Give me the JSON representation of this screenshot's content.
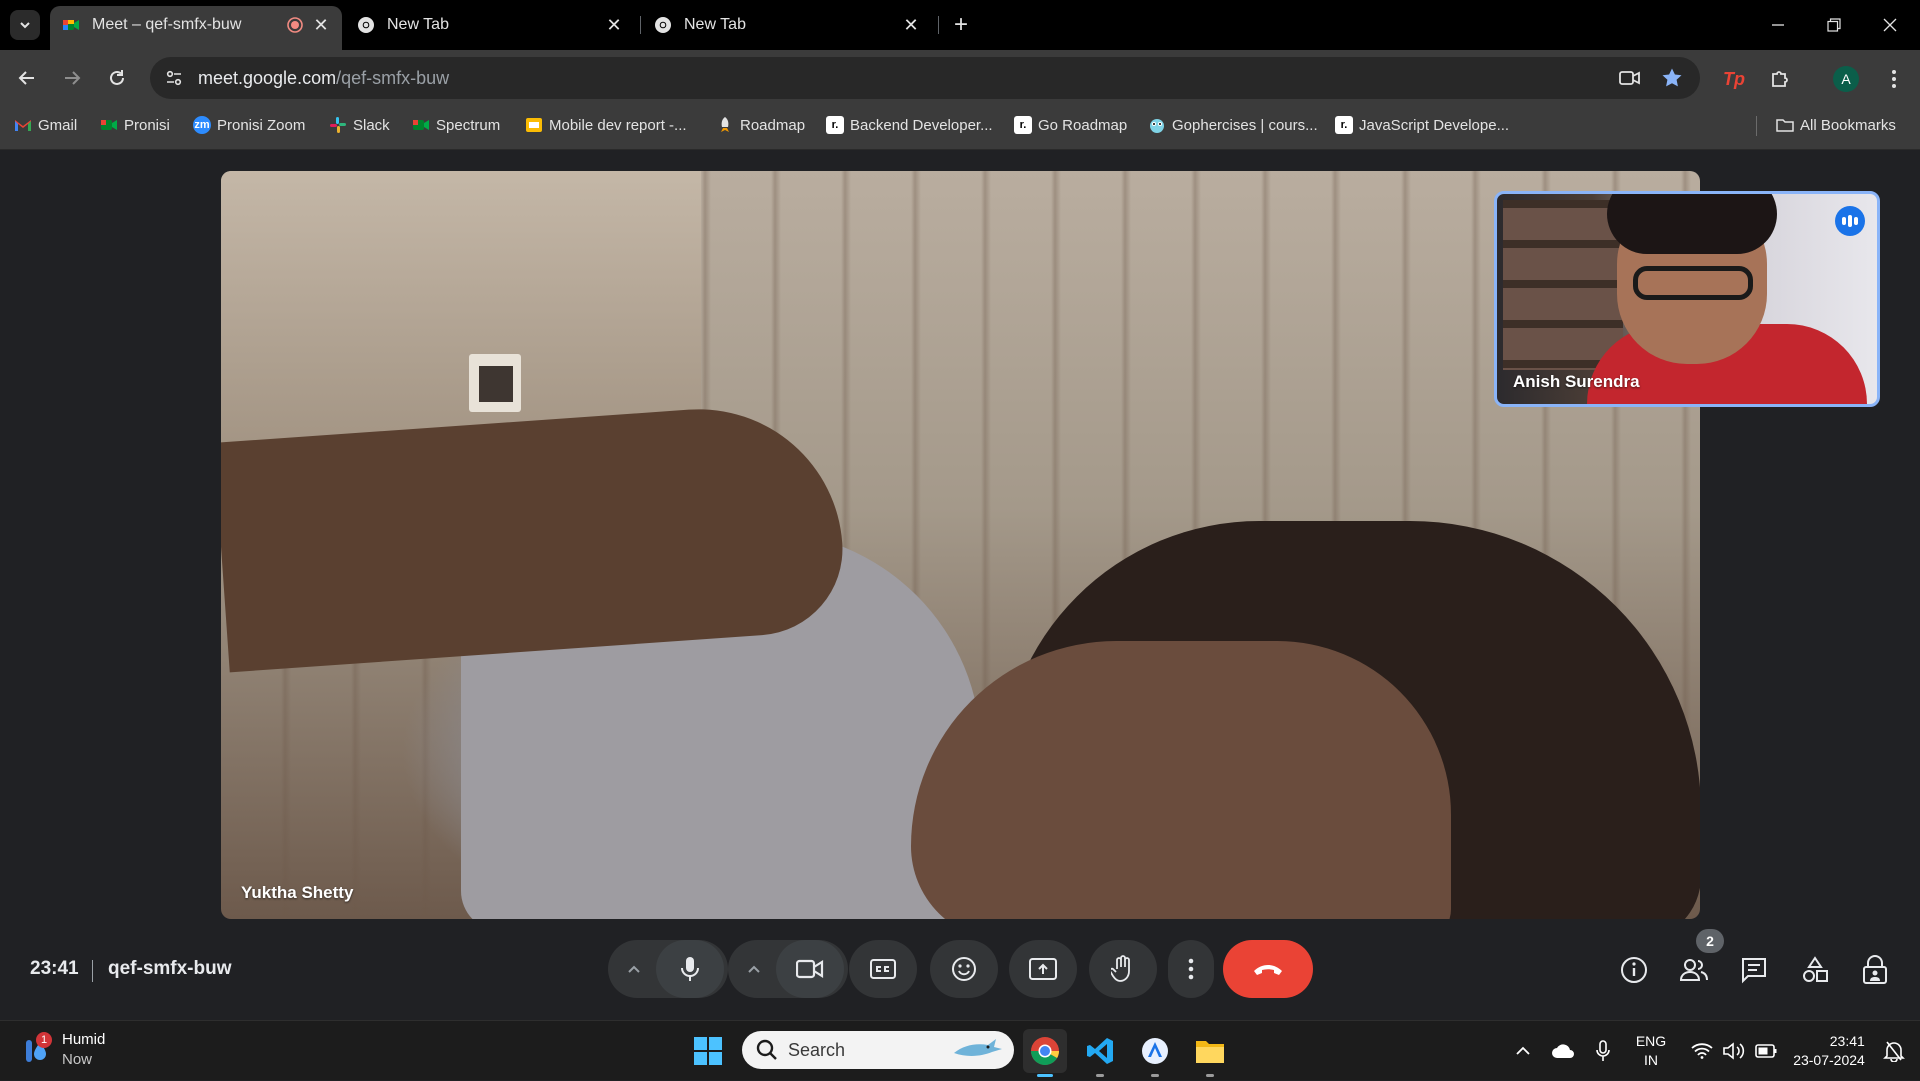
{
  "browser": {
    "tabs": [
      {
        "title": "Meet – qef-smfx-buw",
        "active": true,
        "recording": true
      },
      {
        "title": "New Tab",
        "active": false
      },
      {
        "title": "New Tab",
        "active": false
      }
    ],
    "url": {
      "host": "meet.google.com",
      "path": "/qef-smfx-buw"
    },
    "profile_initial": "A",
    "bookmarks": [
      {
        "label": "Gmail",
        "icon": "gmail-icon"
      },
      {
        "label": "Pronisi",
        "icon": "meet-icon"
      },
      {
        "label": "Pronisi Zoom",
        "icon": "zoom-icon"
      },
      {
        "label": "Slack",
        "icon": "slack-icon"
      },
      {
        "label": "Spectrum",
        "icon": "meet-icon"
      },
      {
        "label": "Mobile dev report -...",
        "icon": "slides-icon"
      },
      {
        "label": "Roadmap",
        "icon": "rocket-icon"
      },
      {
        "label": "Backend Developer...",
        "icon": "roadmap-icon"
      },
      {
        "label": "Go Roadmap",
        "icon": "roadmap-icon"
      },
      {
        "label": "Gophercises | cours...",
        "icon": "gopher-icon"
      },
      {
        "label": "JavaScript Develope...",
        "icon": "roadmap-icon"
      }
    ],
    "all_bookmarks": "All Bookmarks"
  },
  "meet": {
    "main_participant": "Yuktha Shetty",
    "self_participant": "Anish Surendra",
    "time": "23:41",
    "meeting_code": "qef-smfx-buw",
    "people_count": "2",
    "colors": {
      "end_call": "#ea4335",
      "accent": "#8ab4f8",
      "speaking": "#1a73e8"
    }
  },
  "taskbar": {
    "weather": {
      "title": "Humid",
      "sub": "Now",
      "badge": "1"
    },
    "search_placeholder": "Search",
    "lang": {
      "line1": "ENG",
      "line2": "IN"
    },
    "clock": {
      "time": "23:41",
      "date": "23-07-2024"
    }
  }
}
